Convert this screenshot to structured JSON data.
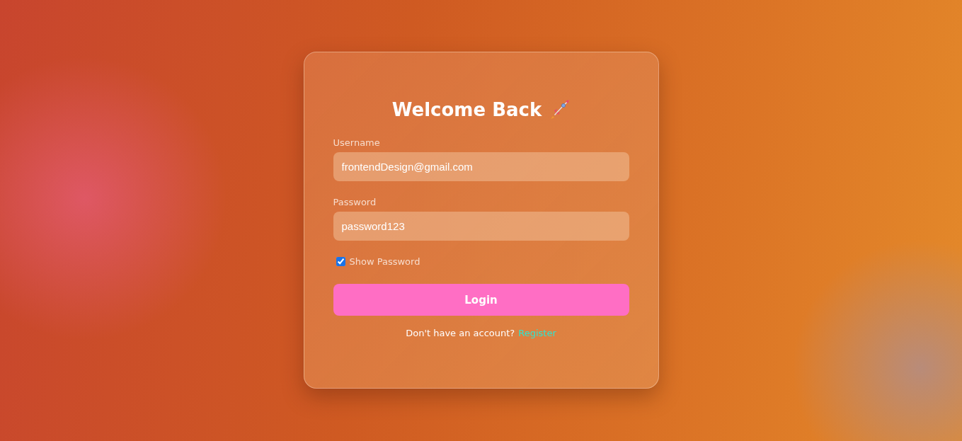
{
  "title": "Welcome Back",
  "fields": [
    {
      "label": "Username",
      "value": "frontendDesign@gmail.com"
    },
    {
      "label": "Password",
      "value": "password123"
    }
  ],
  "show_password": {
    "label": "Show Password",
    "checked": true
  },
  "login_button": "Login",
  "footer": {
    "text": "Don't have an account?",
    "link": "Register"
  }
}
